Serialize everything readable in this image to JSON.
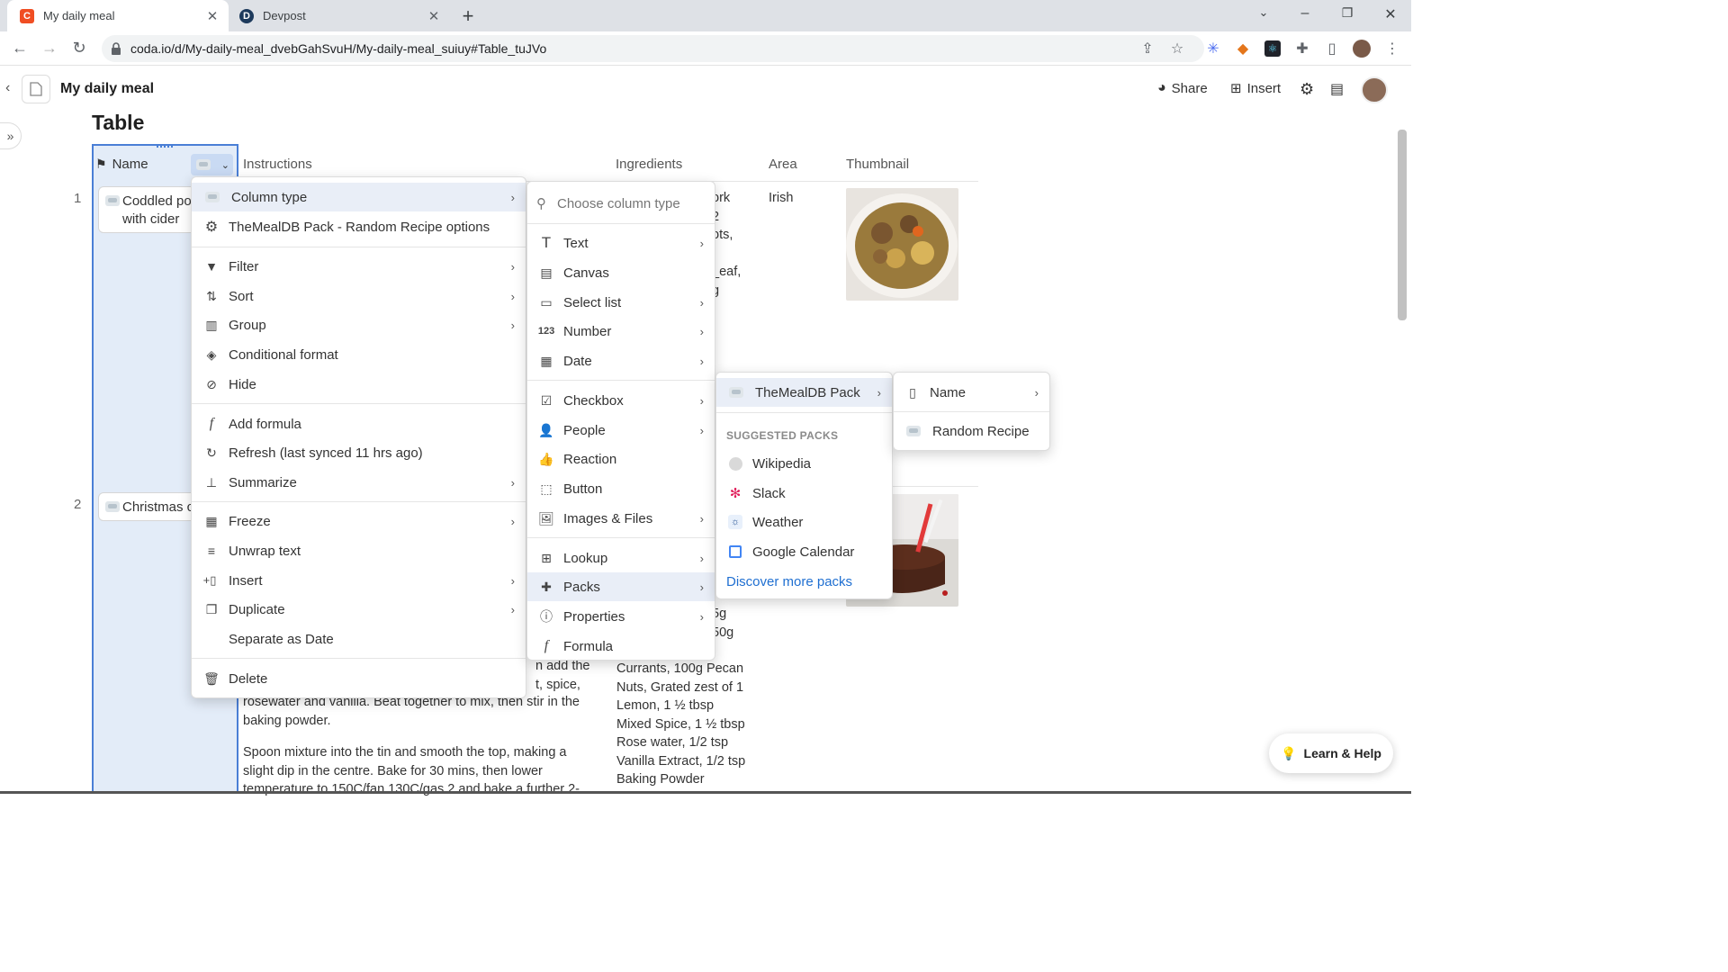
{
  "browser": {
    "tabs": [
      {
        "title": "My daily meal",
        "active": true
      },
      {
        "title": "Devpost",
        "active": false
      }
    ],
    "url": "coda.io/d/My-daily-meal_dvebGahSvuH/My-daily-meal_suiuy#Table_tuJVo"
  },
  "app": {
    "doc_title": "My daily meal",
    "share_label": "Share",
    "insert_label": "Insert"
  },
  "page": {
    "title": "Table"
  },
  "table": {
    "headers": [
      "Name",
      "Instructions",
      "Ingredients",
      "Area",
      "Thumbnail"
    ],
    "rows": [
      {
        "num": "1",
        "name_line1": "Coddled po",
        "name_line2": "with cider",
        "ingredients_frag": [
          "ork",
          "2",
          "ots,",
          "",
          "_eaf,",
          "g"
        ],
        "area": "Irish"
      },
      {
        "num": "2",
        "name_line1": "Christmas c",
        "ingredients_frag": [
          "5g",
          "50g"
        ],
        "instructions_frag": [
          "n add the",
          "t, spice,",
          "rosewater and vanilla. Beat together to mix, then stir in the",
          "baking powder.",
          "Spoon mixture into the tin and smooth the top, making a",
          "slight dip in the centre. Bake for 30 mins, then lower",
          "temperature to 150C/fan 130C/gas 2 and bake a further 2-"
        ],
        "ingredients_more": [
          "Currants, 100g  Pecan",
          "Nuts, Grated zest of 1",
          "Lemon, 1 ½ tbsp",
          "Mixed Spice, 1 ½ tbsp",
          "Rose water, 1/2 tsp",
          "Vanilla Extract, 1/2 tsp",
          "Baking Powder"
        ]
      }
    ]
  },
  "column_menu": {
    "items": [
      {
        "label": "Column type",
        "icon": "pack-icon",
        "submenu": true
      },
      {
        "label": "TheMealDB Pack - Random Recipe options",
        "icon": "gear-icon",
        "submenu": false
      },
      {
        "label": "Filter",
        "icon": "filter-icon",
        "submenu": true
      },
      {
        "label": "Sort",
        "icon": "sort-icon",
        "submenu": true
      },
      {
        "label": "Group",
        "icon": "group-icon",
        "submenu": true
      },
      {
        "label": "Conditional format",
        "icon": "paint-bucket-icon",
        "submenu": false
      },
      {
        "label": "Hide",
        "icon": "eye-off-icon",
        "submenu": false
      },
      {
        "label": "Add formula",
        "icon": "formula-icon",
        "submenu": false
      },
      {
        "label": "Refresh (last synced 11 hrs ago)",
        "icon": "refresh-icon",
        "submenu": false
      },
      {
        "label": "Summarize",
        "icon": "summarize-icon",
        "submenu": true
      },
      {
        "label": "Freeze",
        "icon": "freeze-icon",
        "submenu": true
      },
      {
        "label": "Unwrap text",
        "icon": "unwrap-icon",
        "submenu": false
      },
      {
        "label": "Insert",
        "icon": "insert-column-icon",
        "submenu": true
      },
      {
        "label": "Duplicate",
        "icon": "duplicate-icon",
        "submenu": true
      },
      {
        "label": "Separate as Date",
        "icon": "",
        "submenu": false
      },
      {
        "label": "Delete",
        "icon": "trash-icon",
        "submenu": false
      }
    ]
  },
  "type_menu": {
    "search_placeholder": "Choose column type",
    "items": [
      {
        "label": "Text",
        "submenu": true
      },
      {
        "label": "Canvas",
        "submenu": false
      },
      {
        "label": "Select list",
        "submenu": true
      },
      {
        "label": "Number",
        "submenu": true
      },
      {
        "label": "Date",
        "submenu": true
      },
      {
        "label": "Checkbox",
        "submenu": true
      },
      {
        "label": "People",
        "submenu": true
      },
      {
        "label": "Reaction",
        "submenu": false
      },
      {
        "label": "Button",
        "submenu": false
      },
      {
        "label": "Images & Files",
        "submenu": true
      },
      {
        "label": "Lookup",
        "submenu": true
      },
      {
        "label": "Packs",
        "submenu": true
      },
      {
        "label": "Properties",
        "submenu": true
      },
      {
        "label": "Formula",
        "submenu": false
      }
    ]
  },
  "packs_menu": {
    "installed": "TheMealDB Pack",
    "suggested_label": "SUGGESTED PACKS",
    "suggested": [
      "Wikipedia",
      "Slack",
      "Weather",
      "Google Calendar"
    ],
    "discover": "Discover more packs"
  },
  "pack_types_menu": {
    "items": [
      "Name",
      "Random Recipe"
    ]
  },
  "help": {
    "label": "Learn & Help"
  },
  "colors": {
    "accent": "#4a7fd6",
    "highlight": "#e9eef7",
    "link": "#1f6fd1"
  }
}
